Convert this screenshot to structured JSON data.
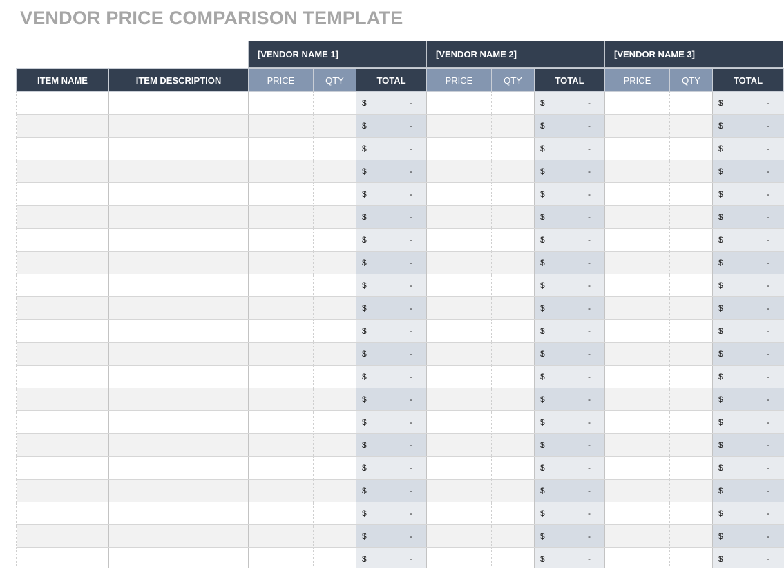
{
  "title": "VENDOR PRICE COMPARISON TEMPLATE",
  "vendors": [
    "[VENDOR NAME 1]",
    "[VENDOR NAME 2]",
    "[VENDOR NAME 3]"
  ],
  "columns": {
    "item_name": "ITEM NAME",
    "item_description": "ITEM DESCRIPTION",
    "price": "PRICE",
    "qty": "QTY",
    "total": "TOTAL"
  },
  "total_cell": {
    "currency": "$",
    "value": "-"
  },
  "row_count": 21,
  "colors": {
    "title_text": "#a6a6a6",
    "header_dark": "#333f50",
    "header_light": "#8496b0",
    "row_alt": "#f2f2f2",
    "total_cell": "#e8ebef",
    "total_cell_alt": "#d6dce4"
  }
}
